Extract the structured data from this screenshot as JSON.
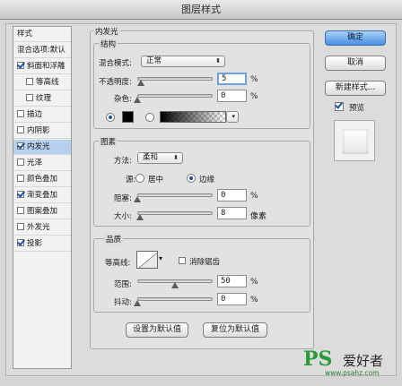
{
  "window": {
    "title": "图层样式"
  },
  "style_list": {
    "header": "样式",
    "blend_options": "混合选项:默认",
    "items": [
      {
        "label": "斜面和浮雕",
        "checked": true
      },
      {
        "label": "等高线",
        "checked": false
      },
      {
        "label": "纹理",
        "checked": false
      },
      {
        "label": "描边",
        "checked": false
      },
      {
        "label": "内阴影",
        "checked": false
      },
      {
        "label": "内发光",
        "checked": true,
        "selected": true
      },
      {
        "label": "光泽",
        "checked": false
      },
      {
        "label": "颜色叠加",
        "checked": false
      },
      {
        "label": "渐变叠加",
        "checked": true
      },
      {
        "label": "图案叠加",
        "checked": false
      },
      {
        "label": "外发光",
        "checked": false
      },
      {
        "label": "投影",
        "checked": true
      }
    ]
  },
  "panel": {
    "title": "内发光",
    "structure": {
      "title": "结构",
      "blend_mode_label": "混合模式:",
      "blend_mode_value": "正常",
      "opacity_label": "不透明度:",
      "opacity_value": "5",
      "opacity_unit": "%",
      "opacity_fraction": 0.05,
      "noise_label": "杂色:",
      "noise_value": "0",
      "noise_unit": "%",
      "noise_fraction": 0.0,
      "color_swatch": "#000000"
    },
    "elements": {
      "title": "图素",
      "method_label": "方法:",
      "method_value": "柔和",
      "source_label": "源:",
      "source_center": "居中",
      "source_edge": "边缘",
      "choke_label": "阻塞:",
      "choke_value": "0",
      "choke_unit": "%",
      "choke_fraction": 0.0,
      "size_label": "大小:",
      "size_value": "8",
      "size_unit": "像素",
      "size_fraction": 0.03
    },
    "quality": {
      "title": "品质",
      "contour_label": "等高线:",
      "anti_alias_label": "消除锯齿",
      "range_label": "范围:",
      "range_value": "50",
      "range_unit": "%",
      "range_fraction": 0.5,
      "jitter_label": "抖动:",
      "jitter_value": "0",
      "jitter_unit": "%",
      "jitter_fraction": 0.0
    },
    "set_default_label": "设置为默认值",
    "reset_default_label": "复位为默认值"
  },
  "buttons": {
    "ok": "确定",
    "cancel": "取消",
    "new_style": "新建样式...",
    "preview_label": "预览"
  },
  "watermark": {
    "logo": "PS",
    "text": "爱好者",
    "url": "www.psahz.com"
  }
}
